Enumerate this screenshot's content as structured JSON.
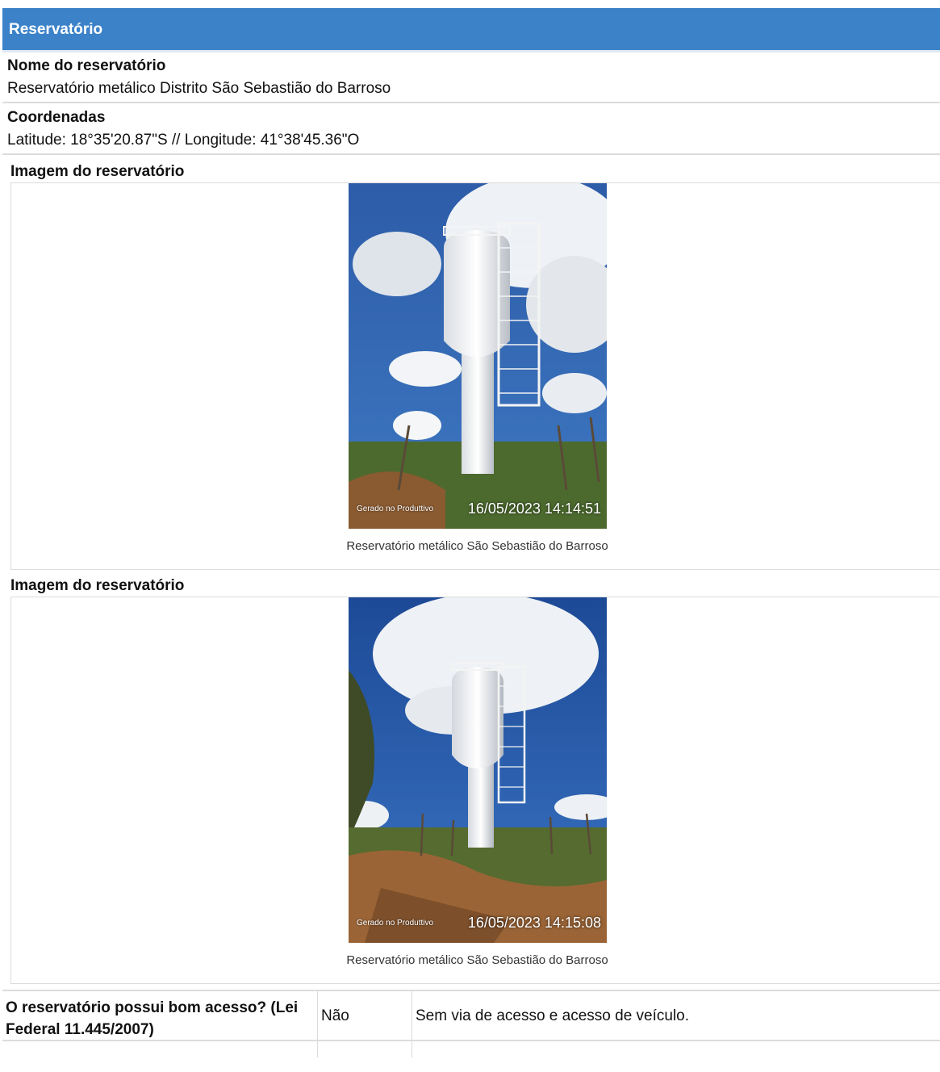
{
  "section": {
    "title": "Reservatório"
  },
  "fields": {
    "name_label": "Nome do reservatório",
    "name_value": "Reservatório metálico Distrito São Sebastião do Barroso",
    "coords_label": "Coordenadas",
    "coords_value": "Latitude: 18°35'20.87\"S // Longitude: 41°38'45.36\"O"
  },
  "images": [
    {
      "label": "Imagem do reservatório",
      "watermark": "Gerado no Produttivo",
      "timestamp": "16/05/2023 14:14:51",
      "caption": "Reservatório metálico São Sebastião do Barroso"
    },
    {
      "label": "Imagem do reservatório",
      "watermark": "Gerado no Produttivo",
      "timestamp": "16/05/2023 14:15:08",
      "caption": "Reservatório metálico São Sebastião do Barroso"
    }
  ],
  "access_row": {
    "question": "O reservatório possui bom acesso? (Lei Federal 11.445/2007)",
    "answer": "Não",
    "note": "Sem via de acesso e acesso de veículo."
  },
  "colors": {
    "header": "#3b82c9",
    "sky": "#1f4f9a",
    "border": "#dcdcdc"
  }
}
